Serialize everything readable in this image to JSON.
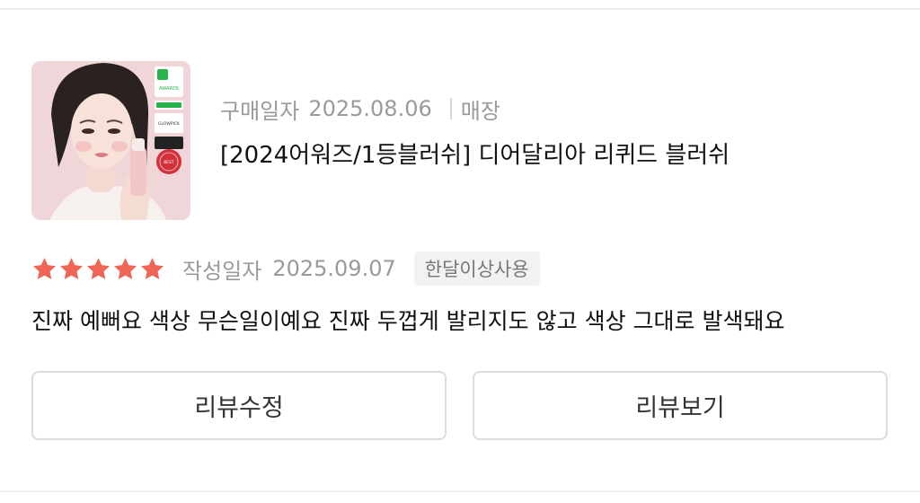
{
  "order": {
    "purchase_label": "구매일자",
    "purchase_date": "2025.08.06",
    "store_label": "매장"
  },
  "product": {
    "name": "[2024어워즈/1등블러쉬] 디어달리아 리퀴드 블러쉬",
    "thumbnail": {
      "badge_top_title": "AWARDS",
      "badge_top_label": "TREND",
      "badge_mid_label": "GLOWPICK",
      "badge_bottom_label": "BEST"
    }
  },
  "review": {
    "rating": 5,
    "rating_max": 5,
    "star_color": "#ef6556",
    "written_label": "작성일자",
    "written_date": "2025.09.07",
    "usage_badge": "한달이상사용",
    "text": "진짜 예뻐요 색상 무슨일이예요 진짜 두껍게 발리지도 않고 색상 그대로 발색돼요"
  },
  "actions": {
    "edit_label": "리뷰수정",
    "view_label": "리뷰보기"
  }
}
